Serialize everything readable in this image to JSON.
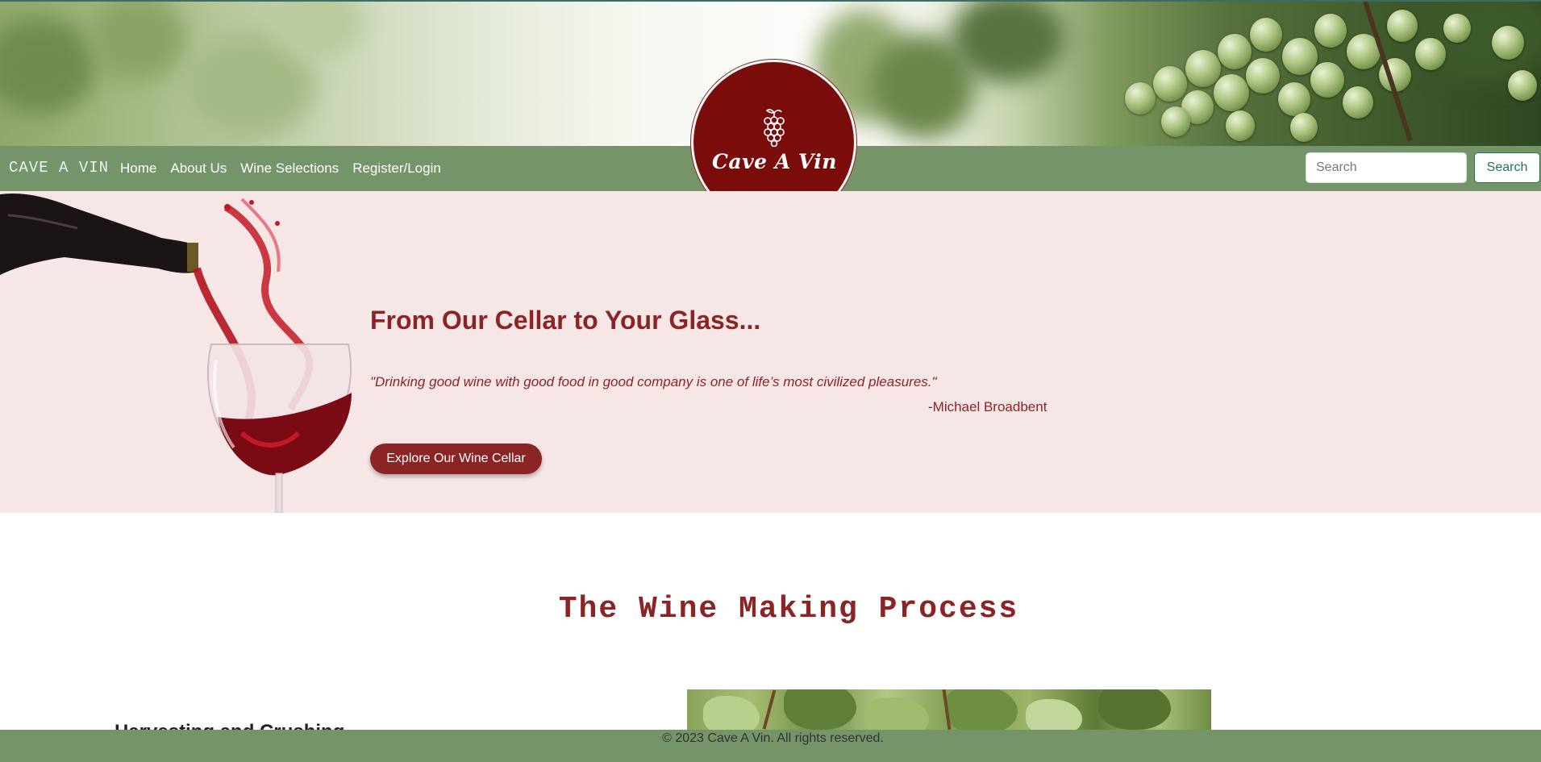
{
  "nav": {
    "brand": "CAVE A VIN",
    "links": [
      "Home",
      "About Us",
      "Wine Selections",
      "Register/Login"
    ],
    "search_placeholder": "Search",
    "search_button": "Search"
  },
  "logo": {
    "text": "Cave A Vin"
  },
  "hero": {
    "title": "From Our Cellar to Your Glass...",
    "quote": "\"Drinking good wine with good food in good company is one of life’s most civilized pleasures.\"",
    "attribution": "-Michael Broadbent",
    "button": "Explore Our Wine Cellar"
  },
  "process": {
    "title": "The Wine Making Process",
    "steps": [
      {
        "heading": "Harvesting and Crushing"
      }
    ]
  },
  "footer": {
    "text": "© 2023 Cave A Vin. All rights reserved."
  },
  "colors": {
    "nav_green": "#76946a",
    "wine_red": "#8b2424",
    "logo_red": "#7a0c0c",
    "hero_pink": "#f7e6e6",
    "search_green": "#1e7a4a"
  },
  "icons": {
    "logo_mark": "grapes-icon"
  }
}
